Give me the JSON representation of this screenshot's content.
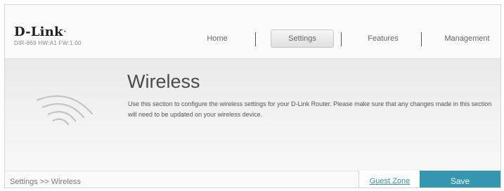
{
  "header": {
    "brand": "D-Link",
    "model_info": "DIR-869 HW:A1 FW:1.00"
  },
  "nav": {
    "items": [
      {
        "label": "Home"
      },
      {
        "label": "Settings",
        "active": true
      },
      {
        "label": "Features"
      },
      {
        "label": "Management"
      }
    ]
  },
  "page": {
    "title": "Wireless",
    "description": "Use this section to configure the wireless settings for your D-Link Router. Please make sure that any changes made in this section will need to be updated on your wireless device.",
    "icon": "wifi-icon"
  },
  "footer": {
    "breadcrumb": "Settings >> Wireless",
    "guest_zone_label": "Guest Zone",
    "save_label": "Save"
  },
  "colors": {
    "accent": "#3596b0",
    "link": "#3b8fb3",
    "title": "#4a4a4a"
  }
}
